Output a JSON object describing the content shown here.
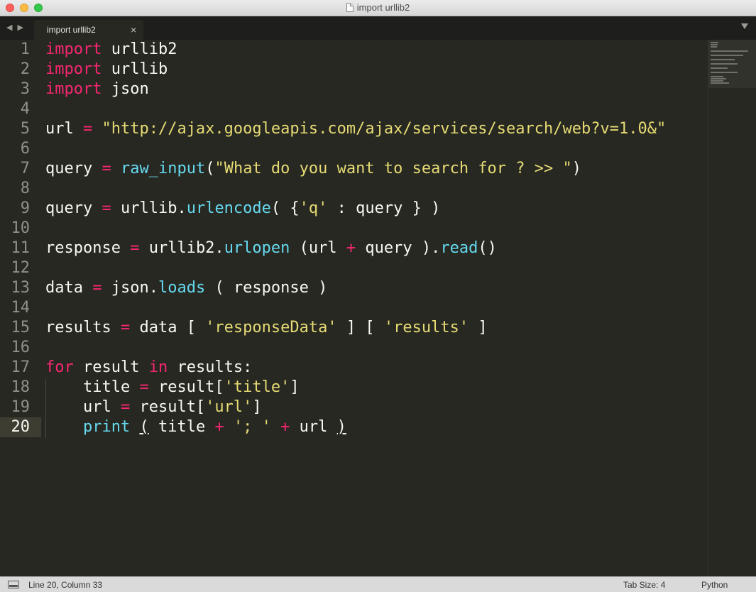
{
  "window": {
    "title": "import urllib2"
  },
  "tab": {
    "label": "import urllib2",
    "close_glyph": "×"
  },
  "nav": {
    "arrows": "◀ ▶"
  },
  "editor": {
    "active_line": 20,
    "lines": [
      [
        [
          "kw",
          "import"
        ],
        [
          "t",
          " urllib2"
        ]
      ],
      [
        [
          "kw",
          "import"
        ],
        [
          "t",
          " urllib"
        ]
      ],
      [
        [
          "kw",
          "import"
        ],
        [
          "t",
          " json"
        ]
      ],
      [],
      [
        [
          "t",
          "url "
        ],
        [
          "op",
          "="
        ],
        [
          "t",
          " "
        ],
        [
          "str",
          "\"http://ajax.googleapis.com/ajax/services/search/web?v=1.0&\""
        ]
      ],
      [],
      [
        [
          "t",
          "query "
        ],
        [
          "op",
          "="
        ],
        [
          "t",
          " "
        ],
        [
          "fn",
          "raw_input"
        ],
        [
          "t",
          "("
        ],
        [
          "str",
          "\"What do you want to search for ? >> \""
        ],
        [
          "t",
          ")"
        ]
      ],
      [],
      [
        [
          "t",
          "query "
        ],
        [
          "op",
          "="
        ],
        [
          "t",
          " urllib."
        ],
        [
          "fn",
          "urlencode"
        ],
        [
          "t",
          "( {"
        ],
        [
          "str",
          "'q'"
        ],
        [
          "t",
          " : query } )"
        ]
      ],
      [],
      [
        [
          "t",
          "response "
        ],
        [
          "op",
          "="
        ],
        [
          "t",
          " urllib2."
        ],
        [
          "fn",
          "urlopen"
        ],
        [
          "t",
          " (url "
        ],
        [
          "op",
          "+"
        ],
        [
          "t",
          " query )."
        ],
        [
          "fn",
          "read"
        ],
        [
          "t",
          "()"
        ]
      ],
      [],
      [
        [
          "t",
          "data "
        ],
        [
          "op",
          "="
        ],
        [
          "t",
          " json."
        ],
        [
          "fn",
          "loads"
        ],
        [
          "t",
          " ( response )"
        ]
      ],
      [],
      [
        [
          "t",
          "results "
        ],
        [
          "op",
          "="
        ],
        [
          "t",
          " data [ "
        ],
        [
          "str",
          "'responseData'"
        ],
        [
          "t",
          " ] [ "
        ],
        [
          "str",
          "'results'"
        ],
        [
          "t",
          " ]"
        ]
      ],
      [],
      [
        [
          "kw",
          "for"
        ],
        [
          "t",
          " result "
        ],
        [
          "kw",
          "in"
        ],
        [
          "t",
          " results:"
        ]
      ],
      [
        [
          "t",
          "    title "
        ],
        [
          "op",
          "="
        ],
        [
          "t",
          " result["
        ],
        [
          "str",
          "'title'"
        ],
        [
          "t",
          "]"
        ]
      ],
      [
        [
          "t",
          "    url "
        ],
        [
          "op",
          "="
        ],
        [
          "t",
          " result["
        ],
        [
          "str",
          "'url'"
        ],
        [
          "t",
          "]"
        ]
      ],
      [
        [
          "t",
          "    "
        ],
        [
          "fn",
          "print"
        ],
        [
          "t",
          " "
        ],
        [
          "br",
          "("
        ],
        [
          "t",
          " title "
        ],
        [
          "op",
          "+"
        ],
        [
          "t",
          " "
        ],
        [
          "str",
          "'; '"
        ],
        [
          "t",
          " "
        ],
        [
          "op",
          "+"
        ],
        [
          "t",
          " url "
        ],
        [
          "br",
          ")"
        ]
      ]
    ]
  },
  "status": {
    "position": "Line 20, Column 33",
    "tab_size": "Tab Size: 4",
    "syntax": "Python"
  },
  "colors": {
    "background": "#272822",
    "keyword": "#f92672",
    "string": "#e6db74",
    "function": "#66d9ef",
    "text": "#f8f8f2"
  }
}
